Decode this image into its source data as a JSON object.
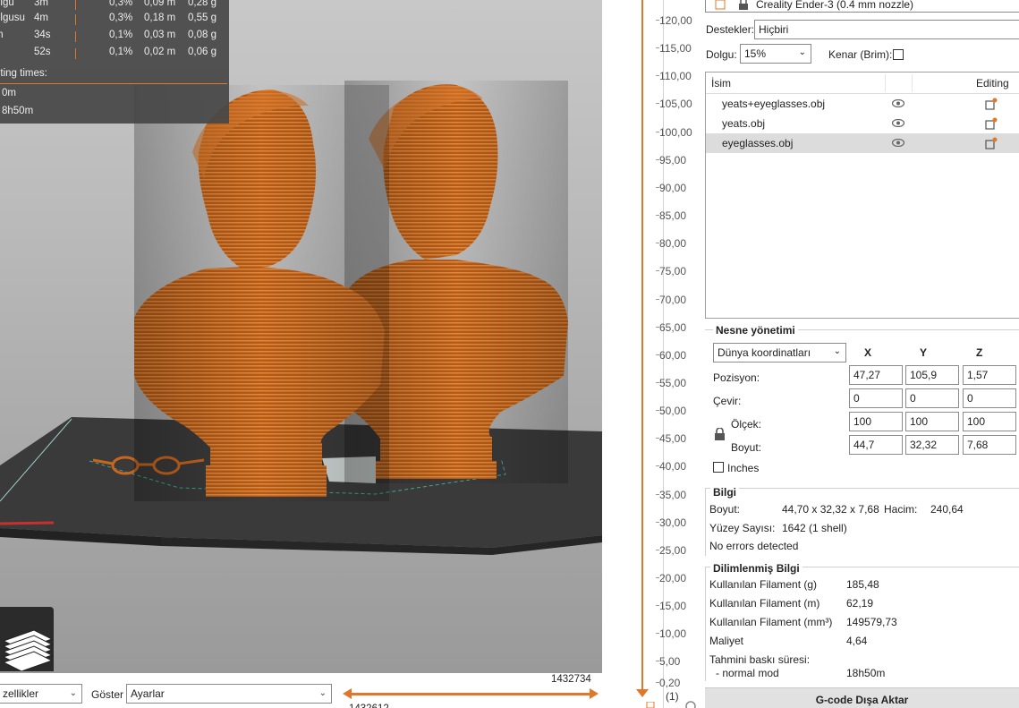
{
  "stats": {
    "rows": [
      {
        "c0": "olgu",
        "c1": "3m",
        "c3": "0,3%",
        "c4": "0,09 m",
        "c5": "0,28 g"
      },
      {
        "c0": "olgusu",
        "c1": "4m",
        "c3": "0,3%",
        "c4": "0,18 m",
        "c5": "0,55 g"
      },
      {
        "c0": "m",
        "c1": "34s",
        "c3": "0,1%",
        "c4": "0,03 m",
        "c5": "0,08 g"
      },
      {
        "c0": "",
        "c1": "52s",
        "c3": "0,1%",
        "c4": "0,02 m",
        "c5": "0,06 g"
      }
    ],
    "times_title": "nting times:",
    "time1": "0m",
    "time2": "8h50m"
  },
  "bottom": {
    "left_combo": "zellikler",
    "show_label": "Göster",
    "show_combo": "Ayarlar",
    "slider_top_value": "1432734",
    "slider_bottom_value": "1432612"
  },
  "vslider": {
    "ticks": [
      "120,00",
      "115,00",
      "110,00",
      "105,00",
      "100,00",
      "95,00",
      "90,00",
      "85,00",
      "80,00",
      "75,00",
      "70,00",
      "65,00",
      "60,00",
      "55,00",
      "50,00",
      "45,00",
      "40,00",
      "35,00",
      "30,00",
      "25,00",
      "20,00",
      "15,00",
      "10,00",
      "5,00",
      "0,20"
    ],
    "bottom_label": "(1)"
  },
  "panel": {
    "printer": "Creality Ender-3 (0.4 mm nozzle)",
    "supports_label": "Destekler:",
    "supports_value": "Hiçbiri",
    "infill_label": "Dolgu:",
    "infill_value": "15%",
    "brim_label": "Kenar (Brim):",
    "brim_checked": false,
    "list": {
      "col_name": "İsim",
      "col_editing": "Editing",
      "items": [
        {
          "name": "yeats+eyeglasses.obj"
        },
        {
          "name": "yeats.obj"
        },
        {
          "name": "eyeglasses.obj"
        }
      ]
    },
    "object_manip": {
      "title": "Nesne yönetimi",
      "coord_system": "Dünya koordinatları",
      "x": "X",
      "y": "Y",
      "z": "Z",
      "position_label": "Pozisyon:",
      "position": [
        "47,27",
        "105,9",
        "1,57"
      ],
      "rotate_label": "Çevir:",
      "rotate": [
        "0",
        "0",
        "0"
      ],
      "scale_label": "Ölçek:",
      "scale": [
        "100",
        "100",
        "100"
      ],
      "size_label": "Boyut:",
      "size": [
        "44,7",
        "32,32",
        "7,68"
      ],
      "inches_label": "Inches",
      "inches_checked": false
    },
    "info": {
      "title": "Bilgi",
      "size_label": "Boyut:",
      "size_value": "44,70 x 32,32 x 7,68",
      "volume_label": "Hacim:",
      "volume_value": "240,64",
      "facets_label": "Yüzey Sayısı:",
      "facets_value": "1642 (1 shell)",
      "errors": "No errors detected"
    },
    "sliced": {
      "title": "Dilimlenmiş Bilgi",
      "rows": [
        {
          "label": "Kullanılan Filament (g)",
          "value": "185,48"
        },
        {
          "label": "Kullanılan Filament (m)",
          "value": "62,19"
        },
        {
          "label": "Kullanılan Filament (mm³)",
          "value": "149579,73"
        },
        {
          "label": "Maliyet",
          "value": "4,64"
        }
      ],
      "time_label": "Tahmini baskı süresi:",
      "mode_label": "- normal mod",
      "mode_value": "18h50m"
    },
    "export_button": "G-code Dışa Aktar"
  },
  "colors": {
    "accent": "#e0782c",
    "model": "#c8661e",
    "bed": "#3a3a3a"
  }
}
